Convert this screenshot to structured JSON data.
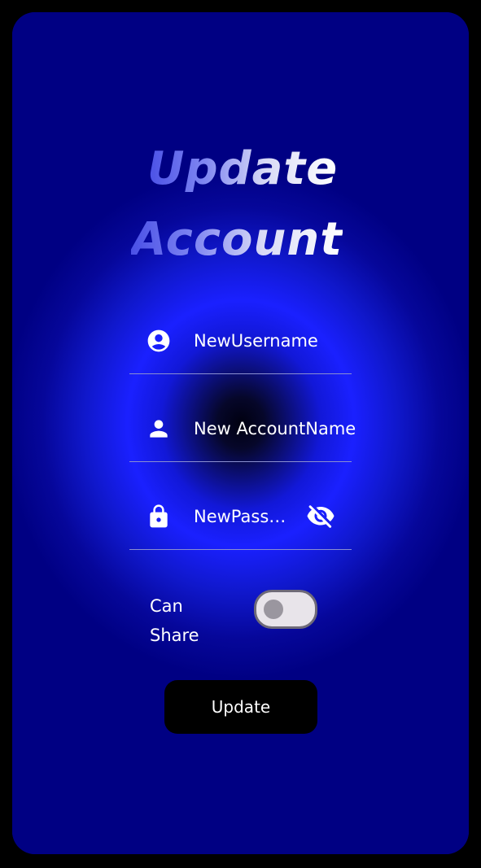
{
  "colors": {
    "page_background": "#000000",
    "card_background": "#000083",
    "glow_accent": "#1a20ff",
    "title_gradient_start": "#4a50e6",
    "title_gradient_end": "#ffffff",
    "button_background": "#000000",
    "text": "#ffffff",
    "toggle_track": "#e8e4ea",
    "toggle_knob": "#9a969f"
  },
  "header": {
    "title_line1": "Update",
    "title_line2": "Account"
  },
  "form": {
    "username": {
      "icon": "account-circle-icon",
      "value": "NewUsername"
    },
    "account_name": {
      "icon": "person-icon",
      "value": "New AccountName"
    },
    "password": {
      "icon": "lock-icon",
      "value": "NewPassword",
      "visibility_icon": "visibility-off-icon"
    },
    "can_share": {
      "label": "Can Share",
      "enabled": false
    }
  },
  "actions": {
    "update_label": "Update"
  }
}
